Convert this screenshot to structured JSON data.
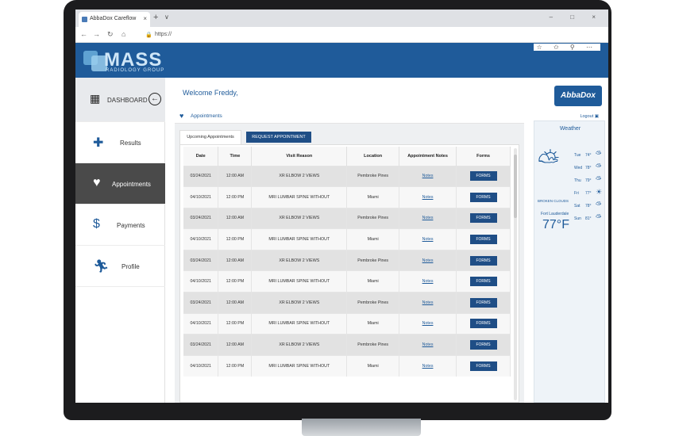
{
  "browser": {
    "tab_title": "AbbaDox Careflow",
    "url": "https://",
    "new_tab": "+",
    "tab_menu": "∨",
    "close": "×",
    "window_controls": "–  □  ×",
    "nav": {
      "back": "←",
      "forward": "→",
      "refresh": "↻",
      "home": "⌂"
    },
    "toolbar_icons": "☆ ✩ ⚲ ⋯"
  },
  "brand": {
    "logo": "MASS",
    "subtitle": "RADIOLOGY GROUP",
    "color": "#1f5b9a",
    "partner_logo": "AbbaDox"
  },
  "sidebar": {
    "items": [
      {
        "label": "DASHBOARD",
        "icon": "grid-icon"
      },
      {
        "label": "Results",
        "icon": "document-plus-icon"
      },
      {
        "label": "Appointments",
        "icon": "heart-pulse-icon",
        "active": true
      },
      {
        "label": "Payments",
        "icon": "dollar-icon"
      },
      {
        "label": "Profile",
        "icon": "running-person-icon"
      }
    ]
  },
  "header": {
    "welcome": "Welcome Freddy,",
    "logout": "Logout"
  },
  "appointments": {
    "title": "Appointments",
    "tabs": {
      "upcoming": "Upcoming Appointments",
      "request": "REQUEST APPOINTMENT"
    },
    "columns": [
      "Date",
      "Time",
      "Visit Reason",
      "Location",
      "Appointment Notes",
      "Forms"
    ],
    "rows": [
      {
        "date": "03/24/2021",
        "time": "12:00 AM",
        "reason": "XR ELBOW 2 VIEWS",
        "location": "Pembroke Pines",
        "notes": "Notes",
        "forms": "FORMS"
      },
      {
        "date": "04/10/2021",
        "time": "12:00 PM",
        "reason": "MRI LUMBAR SPINE WITHOUT",
        "location": "Miami",
        "notes": "Notes",
        "forms": "FORMS"
      },
      {
        "date": "03/24/2021",
        "time": "12:00 AM",
        "reason": "XR ELBOW 2 VIEWS",
        "location": "Pembroke Pines",
        "notes": "Notes",
        "forms": "FORMS"
      },
      {
        "date": "04/10/2021",
        "time": "12:00 PM",
        "reason": "MRI LUMBAR SPINE WITHOUT",
        "location": "Miami",
        "notes": "Notes",
        "forms": "FORMS"
      },
      {
        "date": "03/24/2021",
        "time": "12:00 AM",
        "reason": "XR ELBOW 2 VIEWS",
        "location": "Pembroke Pines",
        "notes": "Notes",
        "forms": "FORMS"
      },
      {
        "date": "04/10/2021",
        "time": "12:00 PM",
        "reason": "MRI LUMBAR SPINE WITHOUT",
        "location": "Miami",
        "notes": "Notes",
        "forms": "FORMS"
      },
      {
        "date": "03/24/2021",
        "time": "12:00 AM",
        "reason": "XR ELBOW 2 VIEWS",
        "location": "Pembroke Pines",
        "notes": "Notes",
        "forms": "FORMS"
      },
      {
        "date": "04/10/2021",
        "time": "12:00 PM",
        "reason": "MRI LUMBAR SPINE WITHOUT",
        "location": "Miami",
        "notes": "Notes",
        "forms": "FORMS"
      },
      {
        "date": "03/24/2021",
        "time": "12:00 AM",
        "reason": "XR ELBOW 2 VIEWS",
        "location": "Pembroke Pines",
        "notes": "Notes",
        "forms": "FORMS"
      },
      {
        "date": "04/10/2021",
        "time": "12:00 PM",
        "reason": "MRI LUMBAR SPINE WITHOUT",
        "location": "Miami",
        "notes": "Notes",
        "forms": "FORMS"
      }
    ]
  },
  "weather": {
    "title": "Weather",
    "condition": "BROKEN CLOUDS",
    "city": "Fort Lauderdale",
    "temp": "77°F",
    "forecast": [
      {
        "day": "Tue",
        "temp": "74°"
      },
      {
        "day": "Wed",
        "temp": "78°"
      },
      {
        "day": "Thu",
        "temp": "79°"
      },
      {
        "day": "Fri",
        "temp": "77°"
      },
      {
        "day": "Sat",
        "temp": "78°"
      },
      {
        "day": "Sun",
        "temp": "81°"
      }
    ]
  }
}
